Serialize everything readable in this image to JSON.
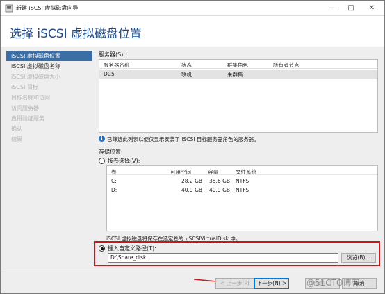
{
  "window": {
    "title": "新建 iSCSI 虚拟磁盘向导",
    "page_title": "选择 iSCSI 虚拟磁盘位置"
  },
  "nav": {
    "items": [
      {
        "label": "iSCSI 虚拟磁盘位置",
        "state": "active"
      },
      {
        "label": "iSCSI 虚拟磁盘名称",
        "state": "normal"
      },
      {
        "label": "iSCSI 虚拟磁盘大小",
        "state": "disabled"
      },
      {
        "label": "iSCSI 目标",
        "state": "disabled"
      },
      {
        "label": "目标名称和访问",
        "state": "disabled"
      },
      {
        "label": "访问服务器",
        "state": "disabled"
      },
      {
        "label": "启用验证服务",
        "state": "disabled"
      },
      {
        "label": "确认",
        "state": "disabled"
      },
      {
        "label": "结果",
        "state": "disabled"
      }
    ]
  },
  "servers": {
    "label": "服务器(S):",
    "columns": [
      "服务器名称",
      "状态",
      "群集角色",
      "所有者节点"
    ],
    "rows": [
      {
        "name": "DC5",
        "status": "联机",
        "cluster_role": "未群集",
        "owner": ""
      }
    ]
  },
  "info": {
    "text": "已筛选此列表以便仅显示安装了 iSCSI 目标服务器角色的服务器。"
  },
  "storage": {
    "label": "存储位置:",
    "by_volume_label": "按卷选择(V):",
    "columns": [
      "卷",
      "可用空间",
      "容量",
      "文件系统"
    ],
    "volumes": [
      {
        "volume": "C:",
        "free": "28.2 GB",
        "capacity": "38.6 GB",
        "fs": "NTFS"
      },
      {
        "volume": "D:",
        "free": "40.9 GB",
        "capacity": "40.9 GB",
        "fs": "NTFS"
      }
    ],
    "note": "iSCSI 虚拟磁盘将保存在选定卷的 \\iSCSIVirtualDisk 中。",
    "custom_path_label": "键入自定义路径(T):",
    "custom_path_value": "D:\\Share_disk",
    "browse_label": "浏览(B)..."
  },
  "buttons": {
    "prev": "< 上一步(P)",
    "next": "下一步(N) >",
    "install": "创建(C)",
    "cancel": "取消"
  },
  "watermark": "@51CTO博客",
  "colors": {
    "accent": "#3a6ea5",
    "title": "#1e4a87",
    "highlight": "#c8161d"
  }
}
